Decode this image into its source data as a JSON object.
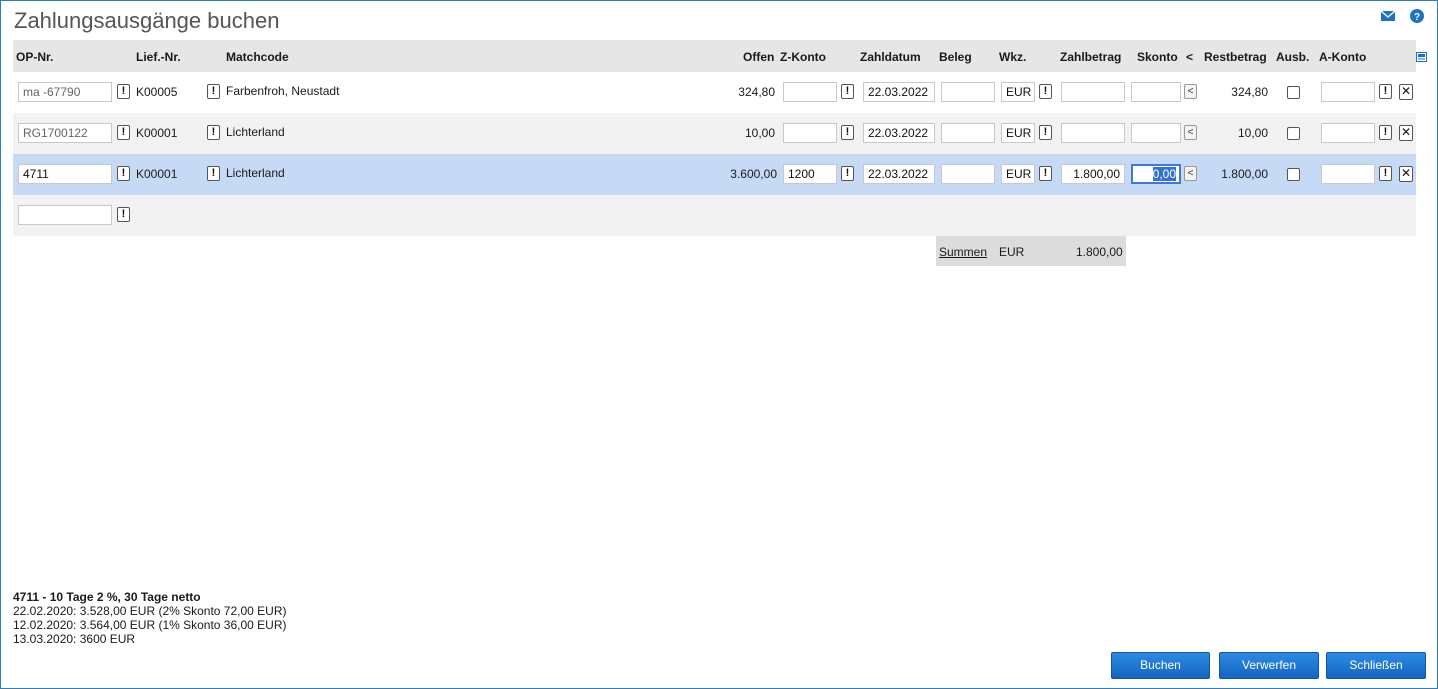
{
  "page": {
    "title": "Zahlungsausgänge buchen"
  },
  "top_icons": {
    "mail": "mail-icon",
    "help": "help-icon"
  },
  "columns": {
    "op_nr": "OP-Nr.",
    "lief_nr": "Lief.-Nr.",
    "matchcode": "Matchcode",
    "offen": "Offen",
    "z_konto": "Z-Konto",
    "zahldatum": "Zahldatum",
    "beleg": "Beleg",
    "wkz": "Wkz.",
    "zahlbetrag": "Zahlbetrag",
    "skonto": "Skonto",
    "lt": "<",
    "restbetrag": "Restbetrag",
    "ausb": "Ausb.",
    "a_konto": "A-Konto"
  },
  "rows": [
    {
      "op_nr": "ma -67790",
      "lief_nr": "K00005",
      "matchcode": "Farbenfroh, Neustadt",
      "offen": "324,80",
      "z_konto": "",
      "zahldatum": "22.03.2022",
      "beleg": "",
      "wkz": "EUR",
      "zahlbetrag": "",
      "skonto": "",
      "restbetrag": "324,80",
      "ausb": false,
      "a_konto": ""
    },
    {
      "op_nr": "RG1700122",
      "lief_nr": "K00001",
      "matchcode": "Lichterland",
      "offen": "10,00",
      "z_konto": "",
      "zahldatum": "22.03.2022",
      "beleg": "",
      "wkz": "EUR",
      "zahlbetrag": "",
      "skonto": "",
      "restbetrag": "10,00",
      "ausb": false,
      "a_konto": ""
    },
    {
      "op_nr": "4711",
      "lief_nr": "K00001",
      "matchcode": "Lichterland",
      "offen": "3.600,00",
      "z_konto": "1200",
      "zahldatum": "22.03.2022",
      "beleg": "",
      "wkz": "EUR",
      "zahlbetrag": "1.800,00",
      "skonto": "0,00",
      "restbetrag": "1.800,00",
      "ausb": false,
      "a_konto": ""
    }
  ],
  "new_row": {
    "op_nr": ""
  },
  "buttons_glyph": {
    "bang": "!",
    "lt": "<",
    "delete": "✕"
  },
  "summen": {
    "label": "Summen",
    "currency": "EUR",
    "total": "1.800,00"
  },
  "info": {
    "title": "4711 - 10 Tage 2 %, 30 Tage netto",
    "lines": [
      "22.02.2020: 3.528,00 EUR (2% Skonto 72,00 EUR)",
      "12.02.2020: 3.564,00 EUR (1% Skonto 36,00 EUR)",
      "13.03.2020: 3600 EUR"
    ]
  },
  "actions": {
    "buchen": "Buchen",
    "verwerfen": "Verwerfen",
    "schliessen": "Schließen"
  },
  "colors": {
    "accent": "#1e73c8",
    "selected_row": "#c7daf5",
    "header_bg": "#e6e6e6"
  }
}
